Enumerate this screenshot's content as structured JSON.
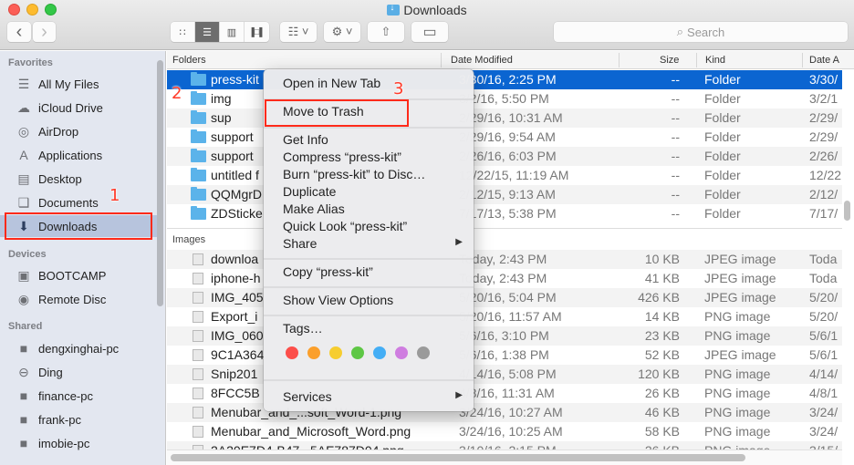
{
  "window": {
    "title": "Downloads",
    "nav_back": "‹",
    "nav_forward": "›",
    "search_placeholder": "Search",
    "search_icon": "⌕",
    "view_buttons": [
      {
        "name": "icon-view",
        "glyph": "∷"
      },
      {
        "name": "list-view",
        "glyph": "☰"
      },
      {
        "name": "column-view",
        "glyph": "▥"
      },
      {
        "name": "cover-flow-view",
        "glyph": "▐□▌"
      }
    ],
    "arrange_glyph": "☷ ˅",
    "action_glyph": "⚙ ˅",
    "share_glyph": "⇧",
    "tag_glyph": "▭"
  },
  "sidebar": {
    "sections": [
      {
        "title": "Favorites",
        "items": [
          {
            "label": "All My Files",
            "icon": "☰"
          },
          {
            "label": "iCloud Drive",
            "icon": "☁"
          },
          {
            "label": "AirDrop",
            "icon": "◎"
          },
          {
            "label": "Applications",
            "icon": "A"
          },
          {
            "label": "Desktop",
            "icon": "▤"
          },
          {
            "label": "Documents",
            "icon": "❑"
          },
          {
            "label": "Downloads",
            "icon": "⬇",
            "selected": true
          }
        ]
      },
      {
        "title": "Devices",
        "items": [
          {
            "label": "BOOTCAMP",
            "icon": "▣"
          },
          {
            "label": "Remote Disc",
            "icon": "◉"
          }
        ]
      },
      {
        "title": "Shared",
        "items": [
          {
            "label": "dengxinghai-pc",
            "icon": "■"
          },
          {
            "label": "Ding",
            "icon": "⊖"
          },
          {
            "label": "finance-pc",
            "icon": "■"
          },
          {
            "label": "frank-pc",
            "icon": "■"
          },
          {
            "label": "imobie-pc",
            "icon": "■"
          }
        ]
      }
    ]
  },
  "columns": {
    "name": "Folders",
    "date_modified": "Date Modified",
    "size": "Size",
    "kind": "Kind",
    "date_added": "Date A"
  },
  "groups": [
    {
      "label": "Folders",
      "rows": [
        {
          "name": "press-kit",
          "date": "3/30/16, 2:25 PM",
          "size": "--",
          "kind": "Folder",
          "added": "3/30/",
          "selected": true
        },
        {
          "name": "img",
          "date": "3/2/16, 5:50 PM",
          "size": "--",
          "kind": "Folder",
          "added": "3/2/1"
        },
        {
          "name": "sup",
          "date": "2/29/16, 10:31 AM",
          "size": "--",
          "kind": "Folder",
          "added": "2/29/"
        },
        {
          "name": "support",
          "date": "2/29/16, 9:54 AM",
          "size": "--",
          "kind": "Folder",
          "added": "2/29/"
        },
        {
          "name": "support",
          "date": "2/26/16, 6:03 PM",
          "size": "--",
          "kind": "Folder",
          "added": "2/26/"
        },
        {
          "name": "untitled f",
          "date": "12/22/15, 11:19 AM",
          "size": "--",
          "kind": "Folder",
          "added": "12/22"
        },
        {
          "name": "QQMgrD",
          "date": "2/12/15, 9:13 AM",
          "size": "--",
          "kind": "Folder",
          "added": "2/12/"
        },
        {
          "name": "ZDSticke",
          "date": "7/17/13, 5:38 PM",
          "size": "--",
          "kind": "Folder",
          "added": "7/17/"
        }
      ]
    },
    {
      "label": "Images",
      "rows": [
        {
          "name": "downloa",
          "date": "Today, 2:43 PM",
          "size": "10 KB",
          "kind": "JPEG image",
          "added": "Toda"
        },
        {
          "name": "iphone-h",
          "date": "Today, 2:43 PM",
          "size": "41 KB",
          "kind": "JPEG image",
          "added": "Toda"
        },
        {
          "name": "IMG_405",
          "date": "5/20/16, 5:04 PM",
          "size": "426 KB",
          "kind": "JPEG image",
          "added": "5/20/"
        },
        {
          "name": "Export_i",
          "date": "5/20/16, 11:57 AM",
          "size": "14 KB",
          "kind": "PNG image",
          "added": "5/20/"
        },
        {
          "name": "IMG_060",
          "date": "5/6/16, 3:10 PM",
          "size": "23 KB",
          "kind": "PNG image",
          "added": "5/6/1"
        },
        {
          "name": "9C1A364",
          "date": "5/6/16, 1:38 PM",
          "size": "52 KB",
          "kind": "JPEG image",
          "added": "5/6/1"
        },
        {
          "name": "Snip201",
          "date": "4/14/16, 5:08 PM",
          "size": "120 KB",
          "kind": "PNG image",
          "added": "4/14/"
        },
        {
          "name": "8FCC5B",
          "date": "4/8/16, 11:31 AM",
          "size": "26 KB",
          "kind": "PNG image",
          "added": "4/8/1"
        },
        {
          "name": "Menubar_and_...soft_Word-1.png",
          "date": "3/24/16, 10:27 AM",
          "size": "46 KB",
          "kind": "PNG image",
          "added": "3/24/"
        },
        {
          "name": "Menubar_and_Microsoft_Word.png",
          "date": "3/24/16, 10:25 AM",
          "size": "58 KB",
          "kind": "PNG image",
          "added": "3/24/"
        },
        {
          "name": "2A20E7D4-B47...5AE787D04.png",
          "date": "3/10/16, 2:15 PM",
          "size": "26 KB",
          "kind": "PNG image",
          "added": "3/15/"
        }
      ]
    }
  ],
  "context_menu": {
    "items": [
      {
        "label": "Open in New Tab"
      },
      {
        "label": "Move to Trash",
        "highlighted": true
      },
      {
        "label": "Get Info"
      },
      {
        "label": "Compress “press-kit”"
      },
      {
        "label": "Burn “press-kit” to Disc…"
      },
      {
        "label": "Duplicate"
      },
      {
        "label": "Make Alias"
      },
      {
        "label": "Quick Look “press-kit”"
      },
      {
        "label": "Share",
        "submenu": true
      },
      {
        "label": "Copy “press-kit”"
      },
      {
        "label": "Show View Options"
      },
      {
        "label": "Tags…"
      },
      {
        "label": "Services",
        "submenu": true
      }
    ],
    "submenu_arrow": "▶",
    "tag_colors": [
      "#fc4e4a",
      "#fb9f2b",
      "#f6cd2f",
      "#5ec745",
      "#44aef5",
      "#cf7de0",
      "#9a9a9a"
    ]
  },
  "annotations": {
    "step1": "1",
    "step2": "2",
    "step3": "3",
    "color": "#ff2a1a"
  }
}
